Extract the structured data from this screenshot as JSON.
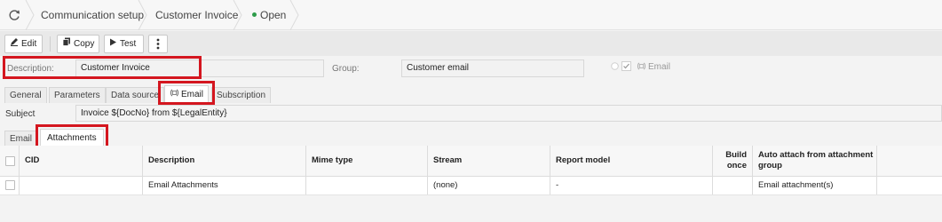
{
  "breadcrumb": {
    "items": [
      "Communication setup",
      "Customer Invoice"
    ],
    "status": "Open",
    "status_color": "#2e9c4a"
  },
  "toolbar": {
    "edit_label": "Edit",
    "copy_label": "Copy",
    "test_label": "Test",
    "more_icon": "vertical-ellipsis-icon"
  },
  "header": {
    "description_label": "Description:",
    "description_value": "Customer Invoice",
    "group_label": "Group:",
    "group_value": "Customer email",
    "email_check_label": "Email"
  },
  "tabs": [
    "General",
    "Parameters",
    "Data source",
    "Email",
    "Subscription"
  ],
  "active_tab": "Email",
  "subject": {
    "label": "Subject",
    "value": "Invoice ${DocNo} from ${LegalEntity}"
  },
  "subtabs": [
    "Email",
    "Attachments"
  ],
  "active_subtab": "Attachments",
  "table": {
    "columns": [
      "CID",
      "Description",
      "Mime type",
      "Stream",
      "Report model",
      "Build once",
      "Auto attach from attachment group"
    ],
    "rows": [
      [
        "",
        "Email Attachments",
        "",
        "(none)",
        "-",
        "",
        "Email attachment(s)"
      ]
    ]
  },
  "highlight_color": "#d4161f"
}
